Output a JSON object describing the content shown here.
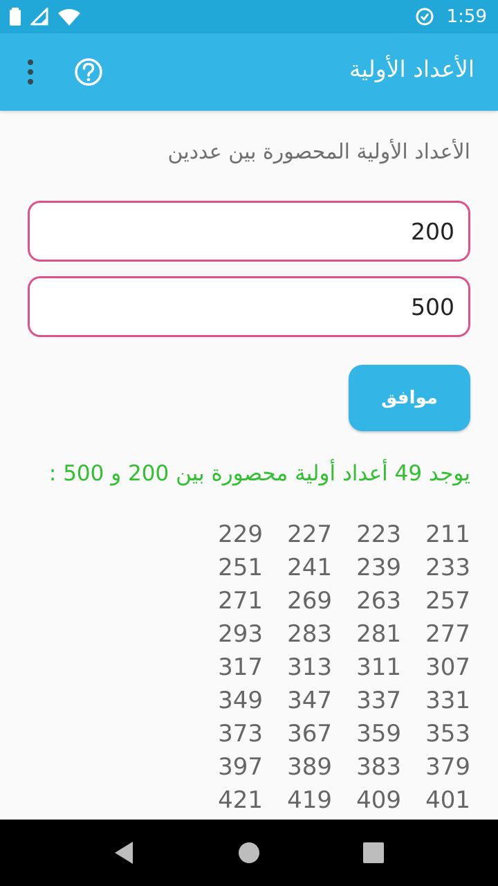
{
  "status_bar": {
    "time": "1:59",
    "icons": [
      "battery-icon",
      "signal-icon",
      "wifi-icon",
      "data-saver-icon"
    ]
  },
  "app_bar": {
    "title": "الأعداد الأولية",
    "help_icon": "help-circle-icon",
    "menu_icon": "more-vert-icon"
  },
  "form": {
    "subtitle": "الأعداد الأولية المحصورة بين عددين",
    "from_value": "200",
    "to_value": "500",
    "ok_label": "موافق"
  },
  "result": {
    "text": "يوجد 49 أعداد أولية محصورة بين 200 و 500 :"
  },
  "primes": [
    211,
    223,
    227,
    229,
    233,
    239,
    241,
    251,
    257,
    263,
    269,
    271,
    277,
    281,
    283,
    293,
    307,
    311,
    313,
    317,
    331,
    337,
    347,
    349,
    353,
    359,
    367,
    373,
    379,
    383,
    389,
    397,
    401,
    409,
    419,
    421
  ],
  "colors": {
    "status_bar": "#21a8d8",
    "app_bar": "#33b5e5",
    "field_border": "#e0508a",
    "result_text": "#2fbf2f"
  },
  "nav_bar": {
    "buttons": [
      "back-icon",
      "home-icon",
      "recents-icon"
    ]
  }
}
